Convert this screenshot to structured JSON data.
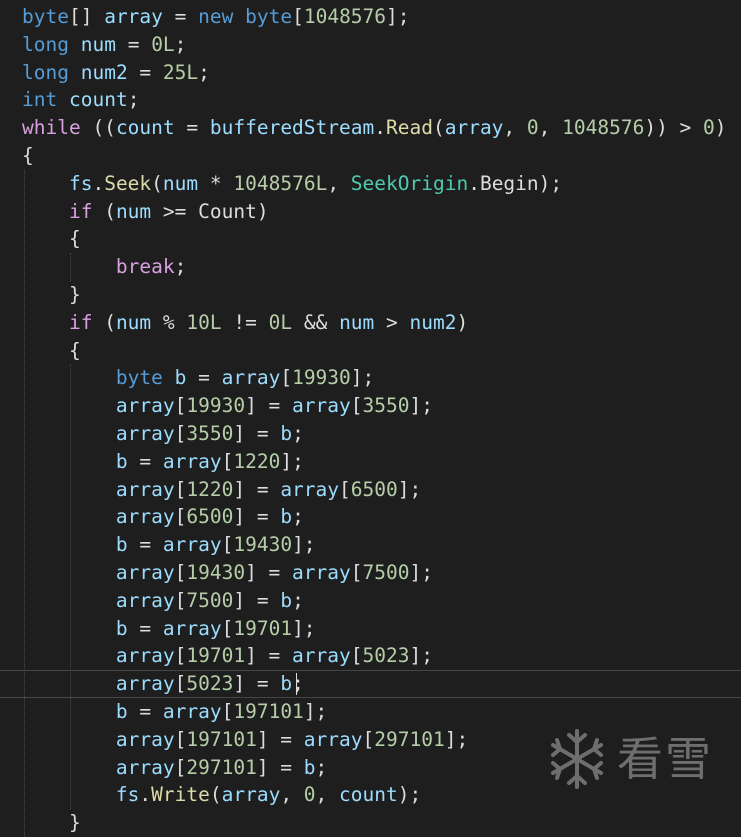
{
  "editor": {
    "lines": [
      {
        "tokens": [
          [
            "byte",
            "kw"
          ],
          [
            "[] ",
            "txt"
          ],
          [
            "array",
            "id"
          ],
          [
            " = ",
            "txt"
          ],
          [
            "new",
            "kw"
          ],
          [
            " ",
            "txt"
          ],
          [
            "byte",
            "kw"
          ],
          [
            "[",
            "txt"
          ],
          [
            "1048576",
            "num"
          ],
          [
            "];",
            "txt"
          ]
        ]
      },
      {
        "tokens": [
          [
            "long",
            "kw"
          ],
          [
            " ",
            "txt"
          ],
          [
            "num",
            "id"
          ],
          [
            " = ",
            "txt"
          ],
          [
            "0L",
            "num"
          ],
          [
            ";",
            "txt"
          ]
        ]
      },
      {
        "tokens": [
          [
            "long",
            "kw"
          ],
          [
            " ",
            "txt"
          ],
          [
            "num2",
            "id"
          ],
          [
            " = ",
            "txt"
          ],
          [
            "25L",
            "num"
          ],
          [
            ";",
            "txt"
          ]
        ]
      },
      {
        "tokens": [
          [
            "int",
            "kw"
          ],
          [
            " ",
            "txt"
          ],
          [
            "count",
            "id"
          ],
          [
            ";",
            "txt"
          ]
        ]
      },
      {
        "tokens": [
          [
            "while",
            "ctl"
          ],
          [
            " ((",
            "txt"
          ],
          [
            "count",
            "id"
          ],
          [
            " = ",
            "txt"
          ],
          [
            "bufferedStream",
            "id"
          ],
          [
            ".",
            "txt"
          ],
          [
            "Read",
            "fn"
          ],
          [
            "(",
            "txt"
          ],
          [
            "array",
            "id"
          ],
          [
            ", ",
            "txt"
          ],
          [
            "0",
            "num"
          ],
          [
            ", ",
            "txt"
          ],
          [
            "1048576",
            "num"
          ],
          [
            ")) > ",
            "txt"
          ],
          [
            "0",
            "num"
          ],
          [
            ")",
            "txt"
          ]
        ]
      },
      {
        "tokens": [
          [
            "{",
            "txt"
          ]
        ]
      },
      {
        "tokens": [
          [
            "    ",
            "txt"
          ],
          [
            "fs",
            "id"
          ],
          [
            ".",
            "txt"
          ],
          [
            "Seek",
            "fn"
          ],
          [
            "(",
            "txt"
          ],
          [
            "num",
            "id"
          ],
          [
            " * ",
            "txt"
          ],
          [
            "1048576L",
            "num"
          ],
          [
            ", ",
            "txt"
          ],
          [
            "SeekOrigin",
            "type"
          ],
          [
            ".",
            "txt"
          ],
          [
            "Begin",
            "txt"
          ],
          [
            ");",
            "txt"
          ]
        ]
      },
      {
        "tokens": [
          [
            "    ",
            "txt"
          ],
          [
            "if",
            "ctl"
          ],
          [
            " (",
            "txt"
          ],
          [
            "num",
            "id"
          ],
          [
            " >= ",
            "txt"
          ],
          [
            "Count",
            "txt"
          ],
          [
            ")",
            "txt"
          ]
        ]
      },
      {
        "tokens": [
          [
            "    {",
            "txt"
          ]
        ]
      },
      {
        "tokens": [
          [
            "        ",
            "txt"
          ],
          [
            "break",
            "ctl"
          ],
          [
            ";",
            "txt"
          ]
        ]
      },
      {
        "tokens": [
          [
            "    }",
            "txt"
          ]
        ]
      },
      {
        "tokens": [
          [
            "    ",
            "txt"
          ],
          [
            "if",
            "ctl"
          ],
          [
            " (",
            "txt"
          ],
          [
            "num",
            "id"
          ],
          [
            " % ",
            "txt"
          ],
          [
            "10L",
            "num"
          ],
          [
            " != ",
            "txt"
          ],
          [
            "0L",
            "num"
          ],
          [
            " && ",
            "txt"
          ],
          [
            "num",
            "id"
          ],
          [
            " > ",
            "txt"
          ],
          [
            "num2",
            "id"
          ],
          [
            ")",
            "txt"
          ]
        ]
      },
      {
        "tokens": [
          [
            "    {",
            "txt"
          ]
        ]
      },
      {
        "tokens": [
          [
            "        ",
            "txt"
          ],
          [
            "byte",
            "kw"
          ],
          [
            " ",
            "txt"
          ],
          [
            "b",
            "id"
          ],
          [
            " = ",
            "txt"
          ],
          [
            "array",
            "id"
          ],
          [
            "[",
            "txt"
          ],
          [
            "19930",
            "num"
          ],
          [
            "];",
            "txt"
          ]
        ]
      },
      {
        "tokens": [
          [
            "        ",
            "txt"
          ],
          [
            "array",
            "id"
          ],
          [
            "[",
            "txt"
          ],
          [
            "19930",
            "num"
          ],
          [
            "] = ",
            "txt"
          ],
          [
            "array",
            "id"
          ],
          [
            "[",
            "txt"
          ],
          [
            "3550",
            "num"
          ],
          [
            "];",
            "txt"
          ]
        ]
      },
      {
        "tokens": [
          [
            "        ",
            "txt"
          ],
          [
            "array",
            "id"
          ],
          [
            "[",
            "txt"
          ],
          [
            "3550",
            "num"
          ],
          [
            "] = ",
            "txt"
          ],
          [
            "b",
            "id"
          ],
          [
            ";",
            "txt"
          ]
        ]
      },
      {
        "tokens": [
          [
            "        ",
            "txt"
          ],
          [
            "b",
            "id"
          ],
          [
            " = ",
            "txt"
          ],
          [
            "array",
            "id"
          ],
          [
            "[",
            "txt"
          ],
          [
            "1220",
            "num"
          ],
          [
            "];",
            "txt"
          ]
        ]
      },
      {
        "tokens": [
          [
            "        ",
            "txt"
          ],
          [
            "array",
            "id"
          ],
          [
            "[",
            "txt"
          ],
          [
            "1220",
            "num"
          ],
          [
            "] = ",
            "txt"
          ],
          [
            "array",
            "id"
          ],
          [
            "[",
            "txt"
          ],
          [
            "6500",
            "num"
          ],
          [
            "];",
            "txt"
          ]
        ]
      },
      {
        "tokens": [
          [
            "        ",
            "txt"
          ],
          [
            "array",
            "id"
          ],
          [
            "[",
            "txt"
          ],
          [
            "6500",
            "num"
          ],
          [
            "] = ",
            "txt"
          ],
          [
            "b",
            "id"
          ],
          [
            ";",
            "txt"
          ]
        ]
      },
      {
        "tokens": [
          [
            "        ",
            "txt"
          ],
          [
            "b",
            "id"
          ],
          [
            " = ",
            "txt"
          ],
          [
            "array",
            "id"
          ],
          [
            "[",
            "txt"
          ],
          [
            "19430",
            "num"
          ],
          [
            "];",
            "txt"
          ]
        ]
      },
      {
        "tokens": [
          [
            "        ",
            "txt"
          ],
          [
            "array",
            "id"
          ],
          [
            "[",
            "txt"
          ],
          [
            "19430",
            "num"
          ],
          [
            "] = ",
            "txt"
          ],
          [
            "array",
            "id"
          ],
          [
            "[",
            "txt"
          ],
          [
            "7500",
            "num"
          ],
          [
            "];",
            "txt"
          ]
        ]
      },
      {
        "tokens": [
          [
            "        ",
            "txt"
          ],
          [
            "array",
            "id"
          ],
          [
            "[",
            "txt"
          ],
          [
            "7500",
            "num"
          ],
          [
            "] = ",
            "txt"
          ],
          [
            "b",
            "id"
          ],
          [
            ";",
            "txt"
          ]
        ]
      },
      {
        "tokens": [
          [
            "        ",
            "txt"
          ],
          [
            "b",
            "id"
          ],
          [
            " = ",
            "txt"
          ],
          [
            "array",
            "id"
          ],
          [
            "[",
            "txt"
          ],
          [
            "19701",
            "num"
          ],
          [
            "];",
            "txt"
          ]
        ]
      },
      {
        "tokens": [
          [
            "        ",
            "txt"
          ],
          [
            "array",
            "id"
          ],
          [
            "[",
            "txt"
          ],
          [
            "19701",
            "num"
          ],
          [
            "] = ",
            "txt"
          ],
          [
            "array",
            "id"
          ],
          [
            "[",
            "txt"
          ],
          [
            "5023",
            "num"
          ],
          [
            "];",
            "txt"
          ]
        ]
      },
      {
        "tokens": [
          [
            "        ",
            "txt"
          ],
          [
            "array",
            "id"
          ],
          [
            "[",
            "txt"
          ],
          [
            "5023",
            "num"
          ],
          [
            "] = ",
            "txt"
          ],
          [
            "b",
            "id"
          ],
          [
            ";",
            "txt"
          ]
        ],
        "current": true
      },
      {
        "tokens": [
          [
            "        ",
            "txt"
          ],
          [
            "b",
            "id"
          ],
          [
            " = ",
            "txt"
          ],
          [
            "array",
            "id"
          ],
          [
            "[",
            "txt"
          ],
          [
            "197101",
            "num"
          ],
          [
            "];",
            "txt"
          ]
        ]
      },
      {
        "tokens": [
          [
            "        ",
            "txt"
          ],
          [
            "array",
            "id"
          ],
          [
            "[",
            "txt"
          ],
          [
            "197101",
            "num"
          ],
          [
            "] = ",
            "txt"
          ],
          [
            "array",
            "id"
          ],
          [
            "[",
            "txt"
          ],
          [
            "297101",
            "num"
          ],
          [
            "];",
            "txt"
          ]
        ]
      },
      {
        "tokens": [
          [
            "        ",
            "txt"
          ],
          [
            "array",
            "id"
          ],
          [
            "[",
            "txt"
          ],
          [
            "297101",
            "num"
          ],
          [
            "] = ",
            "txt"
          ],
          [
            "b",
            "id"
          ],
          [
            ";",
            "txt"
          ]
        ]
      },
      {
        "tokens": [
          [
            "        ",
            "txt"
          ],
          [
            "fs",
            "id"
          ],
          [
            ".",
            "txt"
          ],
          [
            "Write",
            "fn"
          ],
          [
            "(",
            "txt"
          ],
          [
            "array",
            "id"
          ],
          [
            ", ",
            "txt"
          ],
          [
            "0",
            "num"
          ],
          [
            ", ",
            "txt"
          ],
          [
            "count",
            "id"
          ],
          [
            ");",
            "txt"
          ]
        ]
      },
      {
        "tokens": [
          [
            "    }",
            "txt"
          ]
        ]
      }
    ],
    "theme": {
      "background": "#1e1e1e",
      "keyword": "#569cd6",
      "control": "#d8a0df",
      "number": "#b5cea8",
      "identifier": "#9cdcfe",
      "function": "#dcdcaa",
      "type": "#4ec9b0",
      "text": "#dcdcdc"
    }
  },
  "watermark": {
    "icon": "snowflake-icon",
    "text": "看雪"
  }
}
